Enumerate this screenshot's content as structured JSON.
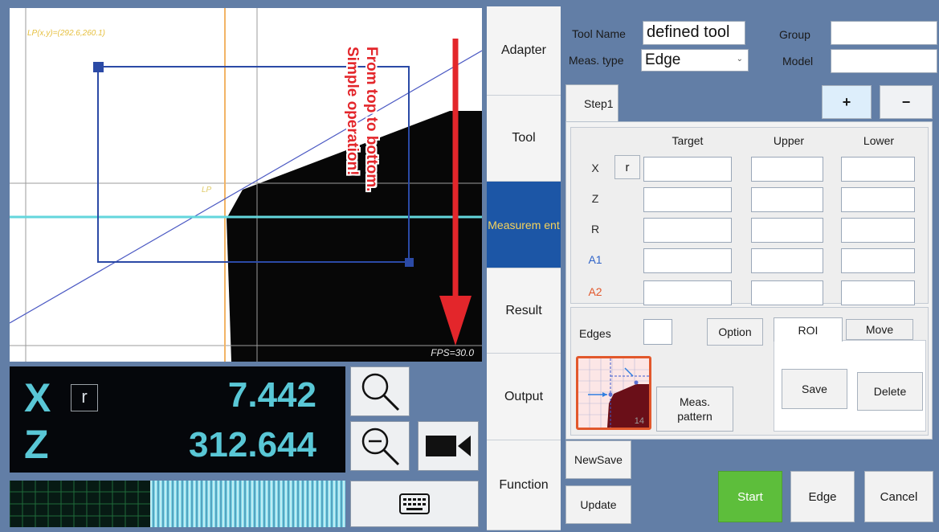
{
  "camera": {
    "lp_readout": "LP(x,y)=(292.6,260.1)",
    "lp_label": "LP",
    "fps": "FPS=30.0",
    "annotation_line1": "From top to bottom.",
    "annotation_line2": "Simple operation!"
  },
  "coords": {
    "x_label": "X",
    "z_label": "Z",
    "r_toggle": "r",
    "x_value": "7.442",
    "z_value": "312.644"
  },
  "nav": {
    "items": [
      {
        "label": "Adapter"
      },
      {
        "label": "Tool"
      },
      {
        "label": "Measurem ent"
      },
      {
        "label": "Result"
      },
      {
        "label": "Output"
      },
      {
        "label": "Function"
      }
    ],
    "active_index": 2
  },
  "tool": {
    "name_label": "Tool Name",
    "name_value": "defined tool",
    "group_label": "Group",
    "group_value": "",
    "meas_type_label": "Meas. type",
    "meas_type_value": "Edge",
    "model_label": "Model",
    "model_value": ""
  },
  "steps": {
    "tab_label": "Step1",
    "add_label": "+",
    "remove_label": "−"
  },
  "table": {
    "headers": [
      "Target",
      "Upper",
      "Lower"
    ],
    "rows": [
      {
        "label": "X",
        "color": "#2a2a2a",
        "target": "",
        "upper": "",
        "lower": ""
      },
      {
        "label": "Z",
        "color": "#2a2a2a",
        "target": "",
        "upper": "",
        "lower": ""
      },
      {
        "label": "R",
        "color": "#2a2a2a",
        "target": "",
        "upper": "",
        "lower": ""
      },
      {
        "label": "A1",
        "color": "#2f63c8",
        "target": "",
        "upper": "",
        "lower": ""
      },
      {
        "label": "A2",
        "color": "#e2582c",
        "target": "",
        "upper": "",
        "lower": ""
      }
    ],
    "r_toggle": "r"
  },
  "edges": {
    "label": "Edges",
    "value": "",
    "option_label": "Option",
    "pattern_number": "14",
    "meas_pattern_line1": "Meas.",
    "meas_pattern_line2": "pattern"
  },
  "roi": {
    "tab_roi": "ROI",
    "tab_move": "Move",
    "save_label": "Save",
    "delete_label": "Delete"
  },
  "footer": {
    "newsave_label": "NewSave",
    "update_label": "Update",
    "start_label": "Start",
    "edge_label": "Edge",
    "cancel_label": "Cancel"
  },
  "colors": {
    "background": "#627ea6",
    "accent_nav": "#1c56a6",
    "nav_active_text": "#f7d35b",
    "start_button": "#5dbe3b",
    "coord_text": "#59c7d6"
  }
}
